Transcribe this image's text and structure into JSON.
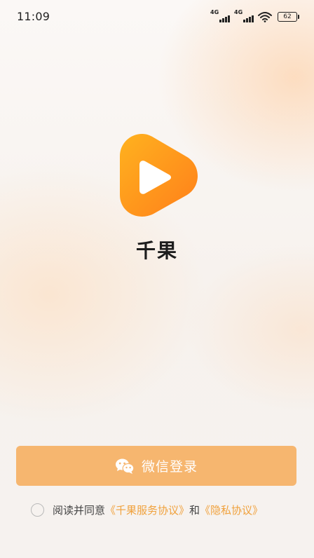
{
  "status_bar": {
    "time": "11:09",
    "signal_1_label": "4G",
    "signal_2_label": "4G",
    "battery_level": "62"
  },
  "app": {
    "name": "千果",
    "logo_icon": "play-triangle-icon",
    "brand_color": "#ff9a1f"
  },
  "login": {
    "wechat_label": "微信登录",
    "wechat_icon": "wechat-icon",
    "button_color": "#f6b66f"
  },
  "agreement": {
    "prefix": "阅读并同意",
    "service_link": "《千果服务协议》",
    "conjunction": "和",
    "privacy_link": "《隐私协议》",
    "link_color": "#f0a13c",
    "checked": false
  }
}
